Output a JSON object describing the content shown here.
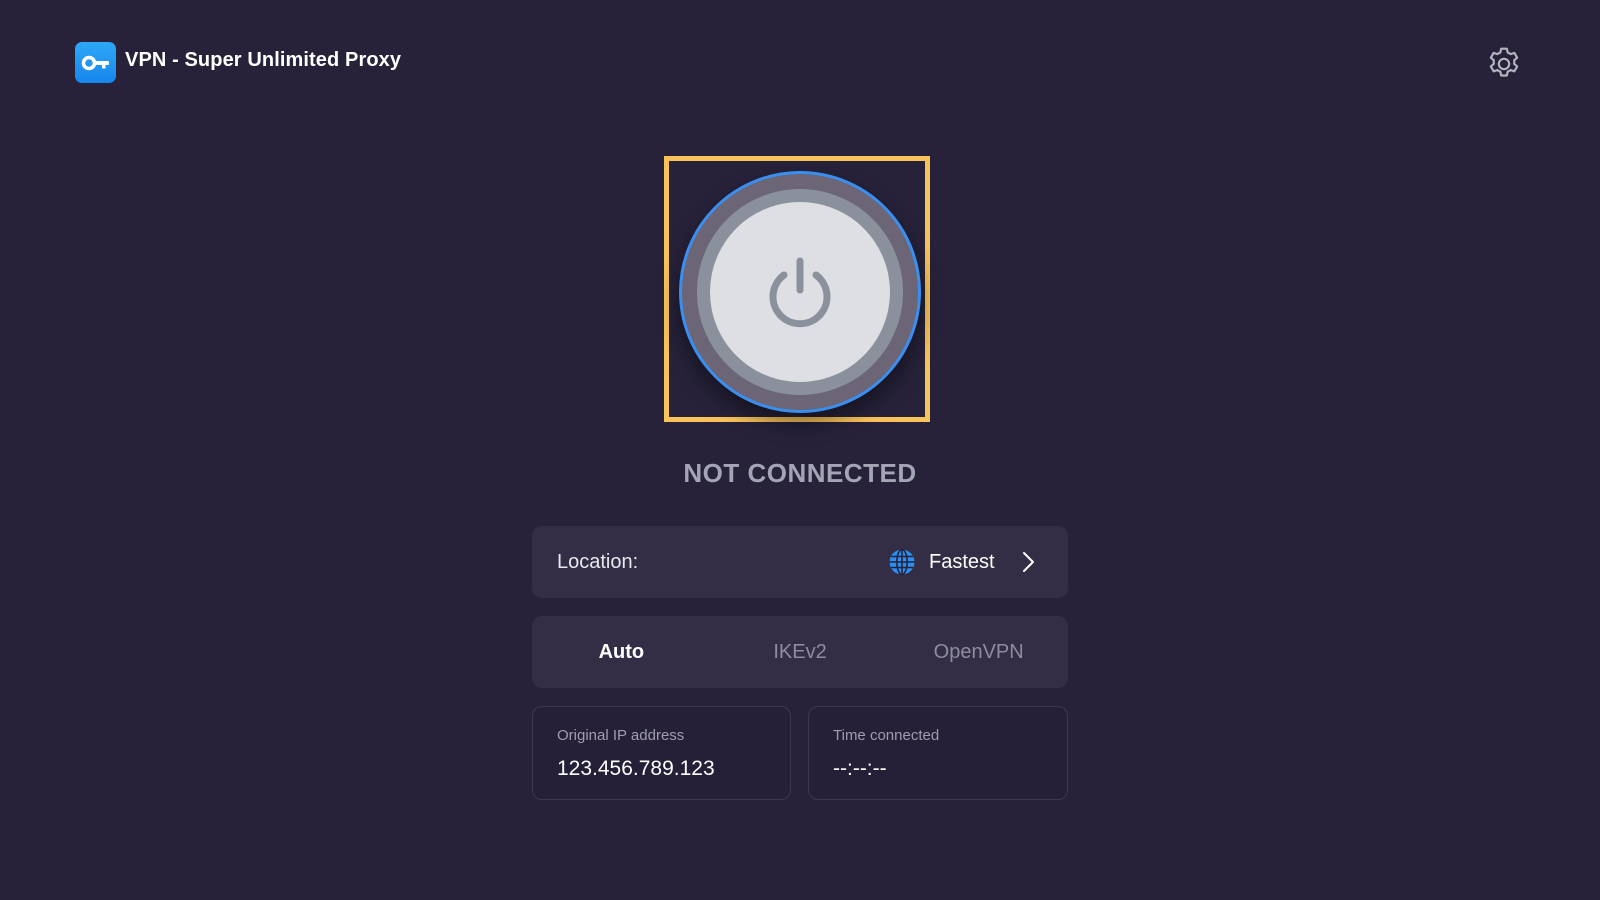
{
  "header": {
    "app_title": "VPN - Super Unlimited Proxy",
    "logo_icon": "key-icon",
    "settings_icon": "gear-icon"
  },
  "power": {
    "icon": "power-icon",
    "status": "NOT CONNECTED"
  },
  "location": {
    "label": "Location:",
    "value": "Fastest",
    "icon": "globe-icon"
  },
  "protocols": {
    "tabs": [
      "Auto",
      "IKEv2",
      "OpenVPN"
    ],
    "selected": "Auto"
  },
  "info": {
    "ip_label": "Original IP address",
    "ip_value": "123.456.789.123",
    "time_label": "Time connected",
    "time_value": "--:--:--"
  },
  "colors": {
    "background": "#27223a",
    "accent_blue": "#3a8ef0",
    "focus_outline": "#fac35a",
    "panel": "#332e45"
  }
}
